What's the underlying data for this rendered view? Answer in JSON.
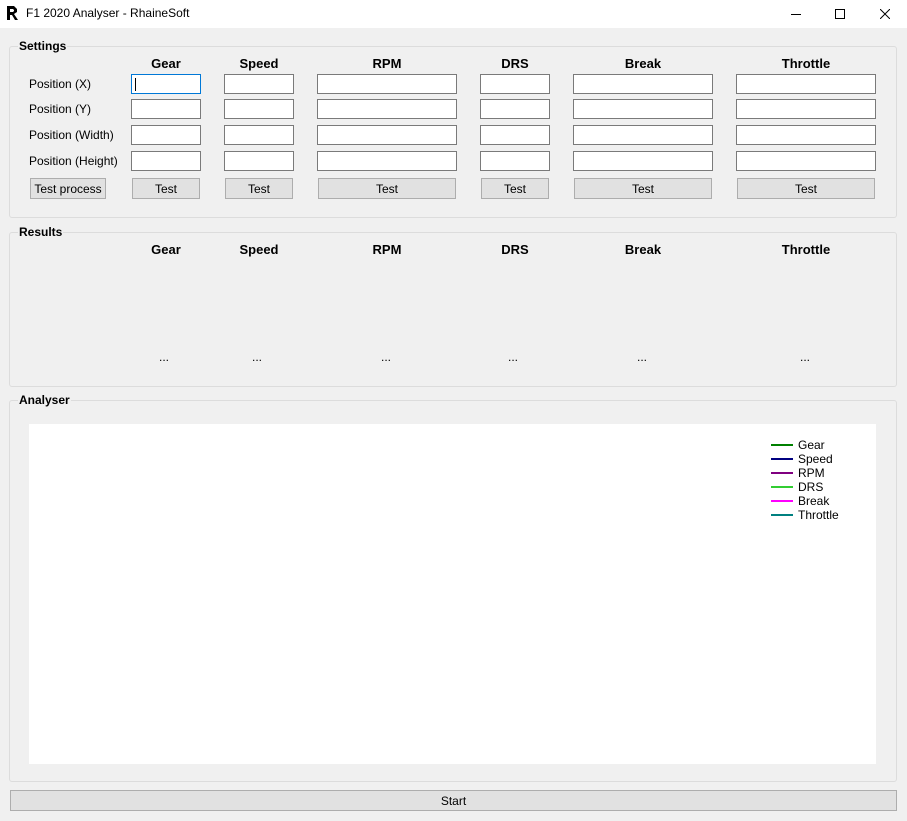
{
  "window": {
    "title": "F1 2020 Analyser - RhaineSoft"
  },
  "settings": {
    "label": "Settings",
    "columns": [
      "Gear",
      "Speed",
      "RPM",
      "DRS",
      "Break",
      "Throttle"
    ],
    "rows": [
      "Position (X)",
      "Position (Y)",
      "Position (Width)",
      "Position (Height)"
    ],
    "test_process_label": "Test process",
    "test_label": "Test"
  },
  "results": {
    "label": "Results",
    "columns": [
      "Gear",
      "Speed",
      "RPM",
      "DRS",
      "Break",
      "Throttle"
    ],
    "values": [
      "...",
      "...",
      "...",
      "...",
      "...",
      "..."
    ]
  },
  "analyser": {
    "label": "Analyser",
    "legend": [
      {
        "name": "Gear",
        "color": "#008000"
      },
      {
        "name": "Speed",
        "color": "#000080"
      },
      {
        "name": "RPM",
        "color": "#800080"
      },
      {
        "name": "DRS",
        "color": "#32cd32"
      },
      {
        "name": "Break",
        "color": "#ff00ff"
      },
      {
        "name": "Throttle",
        "color": "#008080"
      }
    ]
  },
  "start_label": "Start"
}
